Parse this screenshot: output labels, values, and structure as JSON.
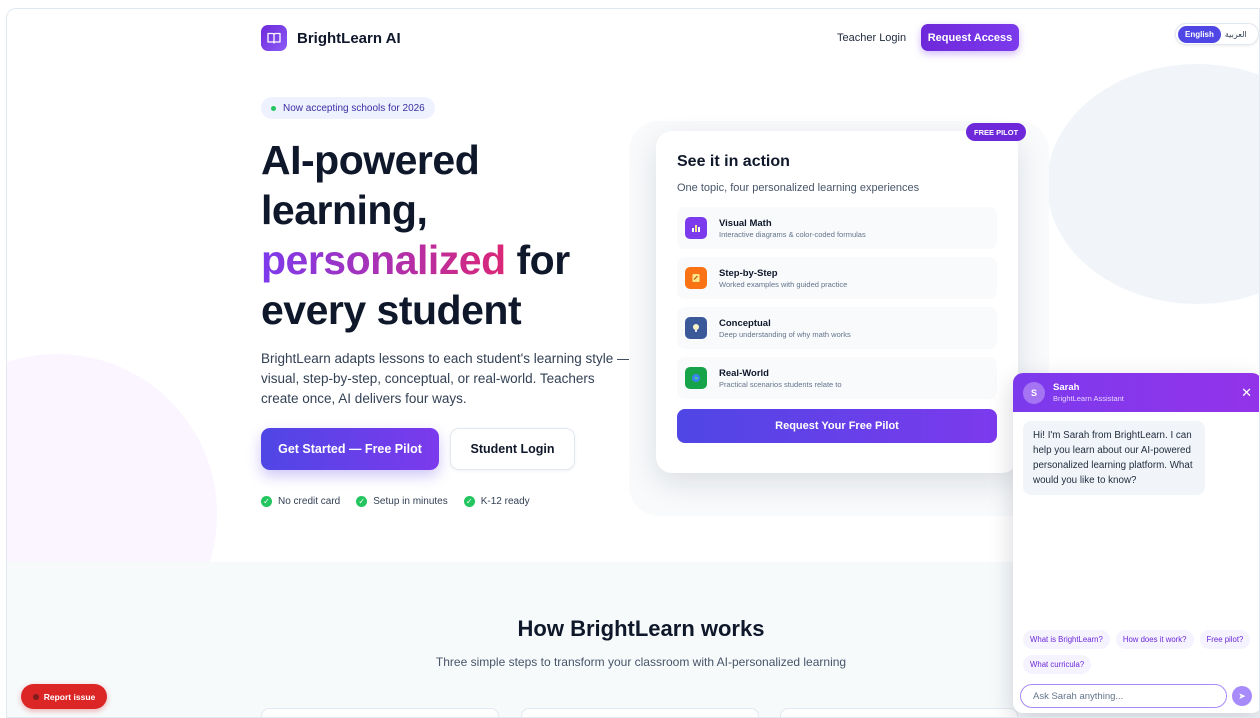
{
  "header": {
    "brand": "BrightLearn AI",
    "teacher_login": "Teacher Login",
    "request_access": "Request Access",
    "lang_english": "English",
    "lang_arabic": "العربية"
  },
  "hero": {
    "badge": "Now accepting schools for 2026",
    "title_line1": "AI-powered",
    "title_line2": "learning,",
    "title_highlight": "personalized",
    "title_for": " for",
    "title_line4": "every student",
    "description": "BrightLearn adapts lessons to each student's learning style — visual, step-by-step, conceptual, or real-world. Teachers create once, AI delivers four ways.",
    "primary_cta": "Get Started — Free Pilot",
    "secondary_cta": "Student Login",
    "checks": [
      "No credit card",
      "Setup in minutes",
      "K-12 ready"
    ]
  },
  "action_card": {
    "badge": "FREE PILOT",
    "title": "See it in action",
    "subtitle": "One topic, four personalized learning experiences",
    "features": [
      {
        "title": "Visual Math",
        "desc": "Interactive diagrams & color-coded formulas",
        "color": "#7c3aed",
        "icon": "chart-icon"
      },
      {
        "title": "Step-by-Step",
        "desc": "Worked examples with guided practice",
        "color": "#f97316",
        "icon": "pencil-icon"
      },
      {
        "title": "Conceptual",
        "desc": "Deep understanding of why math works",
        "color": "#3b5998",
        "icon": "lightbulb-icon"
      },
      {
        "title": "Real-World",
        "desc": "Practical scenarios students relate to",
        "color": "#16a34a",
        "icon": "globe-icon"
      }
    ],
    "cta": "Request Your Free Pilot"
  },
  "how": {
    "title": "How BrightLearn works",
    "subtitle": "Three simple steps to transform your classroom with AI-personalized learning"
  },
  "report": "Report issue",
  "chat": {
    "avatar": "S",
    "name": "Sarah",
    "role": "BrightLearn Assistant",
    "message": "Hi! I'm Sarah from BrightLearn. I can help you learn about our AI-powered personalized learning platform. What would you like to know?",
    "chips": [
      "What is BrightLearn?",
      "How does it work?",
      "Free pilot?",
      "What curricula?"
    ],
    "placeholder": "Ask Sarah anything..."
  }
}
